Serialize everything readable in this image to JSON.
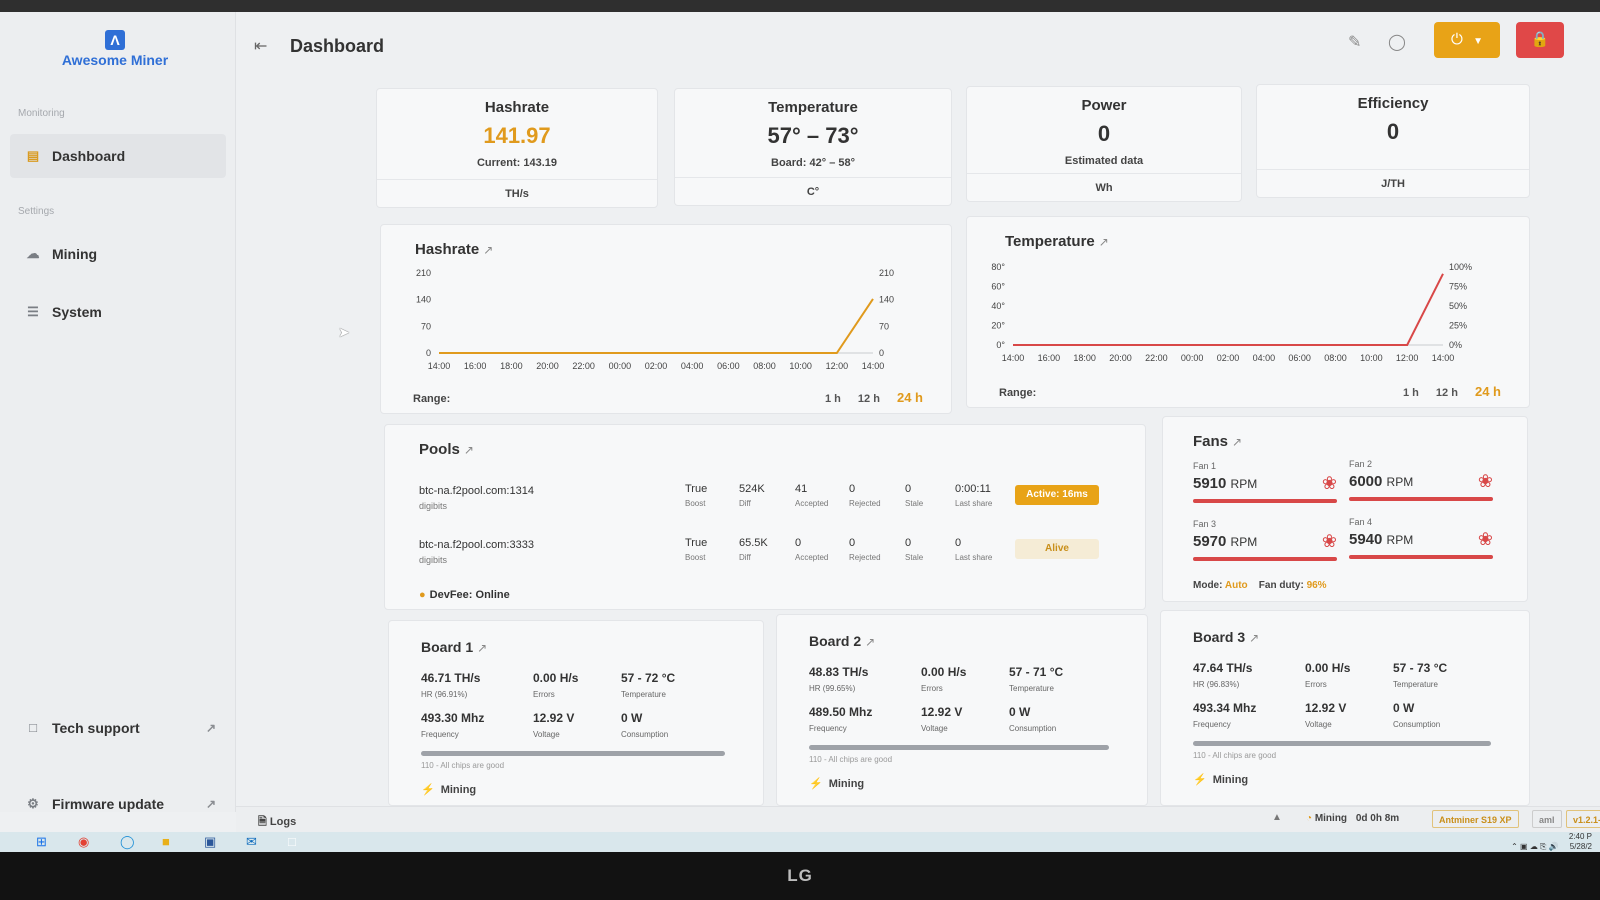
{
  "app": {
    "name": "Awesome Miner",
    "logo_letter": "Λ"
  },
  "header": {
    "title": "Dashboard"
  },
  "sidebar": {
    "monitoring_label": "Monitoring",
    "settings_label": "Settings",
    "items": [
      {
        "label": "Dashboard",
        "icon": "chart-icon"
      },
      {
        "label": "Mining",
        "icon": "miner-icon"
      },
      {
        "label": "System",
        "icon": "sliders-icon"
      },
      {
        "label": "Tech support",
        "icon": "chat-icon"
      },
      {
        "label": "Firmware update",
        "icon": "gear-icon"
      }
    ]
  },
  "stats": {
    "hashrate": {
      "title": "Hashrate",
      "value": "141.97",
      "sub": "Current: 143.19",
      "unit": "TH/s"
    },
    "temperature": {
      "title": "Temperature",
      "value": "57° – 73°",
      "sub": "Board: 42° – 58°",
      "unit": "C°"
    },
    "power": {
      "title": "Power",
      "value": "0",
      "sub": "Estimated data",
      "unit": "Wh"
    },
    "efficiency": {
      "title": "Efficiency",
      "value": "0",
      "unit": "J/TH"
    }
  },
  "charts": {
    "range_label": "Range:",
    "range_options": [
      "1 h",
      "12 h",
      "24 h"
    ],
    "selected_range": "24 h"
  },
  "chart_data": [
    {
      "type": "line",
      "title": "Hashrate",
      "x": [
        "14:00",
        "16:00",
        "18:00",
        "20:00",
        "22:00",
        "00:00",
        "02:00",
        "04:00",
        "06:00",
        "08:00",
        "10:00",
        "12:00",
        "14:00"
      ],
      "y_ticks": [
        0,
        70,
        140,
        210
      ],
      "y_ticks_right": [
        0,
        70,
        140,
        210
      ],
      "ylim": [
        0,
        210
      ],
      "series": [
        {
          "values": [
            0,
            0,
            0,
            0,
            0,
            0,
            0,
            0,
            0,
            0,
            0,
            0,
            141.97
          ]
        }
      ],
      "color": "#e09a1d"
    },
    {
      "type": "line",
      "title": "Temperature",
      "x": [
        "14:00",
        "16:00",
        "18:00",
        "20:00",
        "22:00",
        "00:00",
        "02:00",
        "04:00",
        "06:00",
        "08:00",
        "10:00",
        "12:00",
        "14:00"
      ],
      "y_ticks": [
        "0°",
        "20°",
        "40°",
        "60°",
        "80°"
      ],
      "y_ticks_right": [
        "0%",
        "25%",
        "50%",
        "75%",
        "100%"
      ],
      "ylim": [
        0,
        80
      ],
      "series": [
        {
          "values": [
            0,
            0,
            0,
            0,
            0,
            0,
            0,
            0,
            0,
            0,
            0,
            0,
            73
          ]
        }
      ],
      "color": "#d84848"
    }
  ],
  "pools": {
    "title": "Pools",
    "rows": [
      {
        "host": "btc-na.f2pool.com:1314",
        "user": "digibits",
        "boost": "True",
        "boost_label": "Boost",
        "diff": "524K",
        "diff_label": "Diff",
        "accepted": "41",
        "accepted_label": "Accepted",
        "rejected": "0",
        "rejected_label": "Rejected",
        "stale": "0",
        "stale_label": "Stale",
        "last_share": "0:00:11",
        "last_share_label": "Last share",
        "status": "Active: 16ms"
      },
      {
        "host": "btc-na.f2pool.com:3333",
        "user": "digibits",
        "boost": "True",
        "boost_label": "Boost",
        "diff": "65.5K",
        "diff_label": "Diff",
        "accepted": "0",
        "accepted_label": "Accepted",
        "rejected": "0",
        "rejected_label": "Rejected",
        "stale": "0",
        "stale_label": "Stale",
        "last_share": "0",
        "last_share_label": "Last share",
        "status": "Alive"
      }
    ],
    "devfee": "DevFee: Online"
  },
  "fans": {
    "title": "Fans",
    "items": [
      {
        "label": "Fan 1",
        "rpm": "5910",
        "unit": "RPM"
      },
      {
        "label": "Fan 2",
        "rpm": "6000",
        "unit": "RPM"
      },
      {
        "label": "Fan 3",
        "rpm": "5970",
        "unit": "RPM"
      },
      {
        "label": "Fan 4",
        "rpm": "5940",
        "unit": "RPM"
      }
    ],
    "mode_label": "Mode:",
    "mode": "Auto",
    "duty_label": "Fan duty:",
    "duty": "96%"
  },
  "boards": [
    {
      "title": "Board 1",
      "hr": "46.71 TH/s",
      "hr_label": "HR (96.91%)",
      "errors": "0.00 H/s",
      "errors_label": "Errors",
      "temp": "57 - 72 °C",
      "temp_label": "Temperature",
      "freq": "493.30 Mhz",
      "freq_label": "Frequency",
      "voltage": "12.92 V",
      "voltage_label": "Voltage",
      "consumption": "0 W",
      "consumption_label": "Consumption",
      "chips": "110 - All chips are good",
      "status": "Mining",
      "progress": 1.0
    },
    {
      "title": "Board 2",
      "hr": "48.83 TH/s",
      "hr_label": "HR (99.65%)",
      "errors": "0.00 H/s",
      "errors_label": "Errors",
      "temp": "57 - 71 °C",
      "temp_label": "Temperature",
      "freq": "489.50 Mhz",
      "freq_label": "Frequency",
      "voltage": "12.92 V",
      "voltage_label": "Voltage",
      "consumption": "0 W",
      "consumption_label": "Consumption",
      "chips": "110 - All chips are good",
      "status": "Mining",
      "progress": 1.0
    },
    {
      "title": "Board 3",
      "hr": "47.64 TH/s",
      "hr_label": "HR (96.83%)",
      "errors": "0.00 H/s",
      "errors_label": "Errors",
      "temp": "57 - 73 °C",
      "temp_label": "Temperature",
      "freq": "493.34 Mhz",
      "freq_label": "Frequency",
      "voltage": "12.92 V",
      "voltage_label": "Voltage",
      "consumption": "0 W",
      "consumption_label": "Consumption",
      "chips": "110 - All chips are good",
      "status": "Mining",
      "progress": 1.0
    }
  ],
  "statusbar": {
    "logs": "Logs",
    "mining": "Mining",
    "uptime": "0d 0h 8m",
    "model": "Antminer S19 XP",
    "mode": "aml",
    "version": "v1.2.1-"
  },
  "taskbar": {
    "time": "2:40 P",
    "date": "5/28/2"
  },
  "bezel": {
    "brand": "LG"
  },
  "colors": {
    "accent": "#e09a1d",
    "danger": "#e04848",
    "brand": "#2f6fd6"
  }
}
